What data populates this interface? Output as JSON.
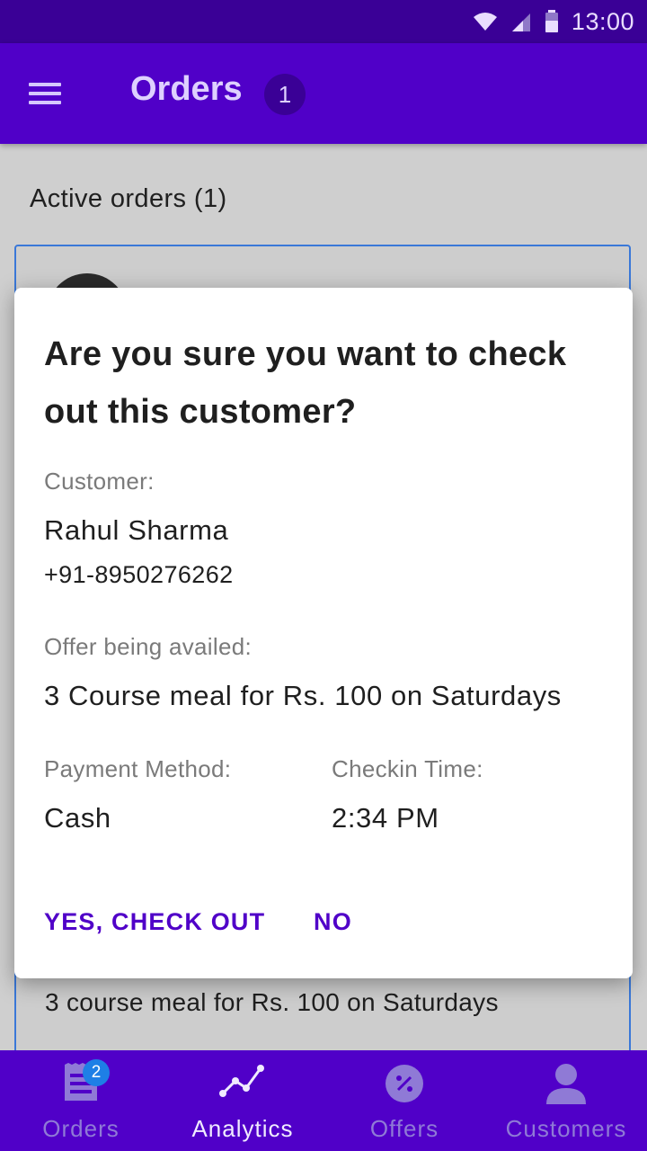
{
  "status_bar": {
    "time": "13:00"
  },
  "app_bar": {
    "title": "Orders",
    "count": "1"
  },
  "orders": {
    "section_title": "Active orders (1)",
    "card_offer": "3 course meal for Rs. 100 on Saturdays"
  },
  "dialog": {
    "title": "Are you sure you want to check out this customer?",
    "customer_label": "Customer:",
    "customer_name": "Rahul Sharma",
    "customer_phone": "+91-8950276262",
    "offer_label": "Offer being availed:",
    "offer_value": "3 Course meal for Rs. 100 on Saturdays",
    "payment_label": "Payment Method:",
    "payment_value": "Cash",
    "checkin_label": "Checkin Time:",
    "checkin_value": "2:34 PM",
    "confirm_label": "YES, CHECK OUT",
    "cancel_label": "NO"
  },
  "bottom_nav": {
    "items": [
      {
        "label": "Orders",
        "icon": "receipt-icon",
        "badge": "2"
      },
      {
        "label": "Analytics",
        "icon": "analytics-icon",
        "active": true
      },
      {
        "label": "Offers",
        "icon": "offer-badge-icon"
      },
      {
        "label": "Customers",
        "icon": "person-icon"
      }
    ]
  },
  "colors": {
    "primary": "#5000c8",
    "status_bar": "#3a0096",
    "accent_badge": "#1e7fe6"
  }
}
